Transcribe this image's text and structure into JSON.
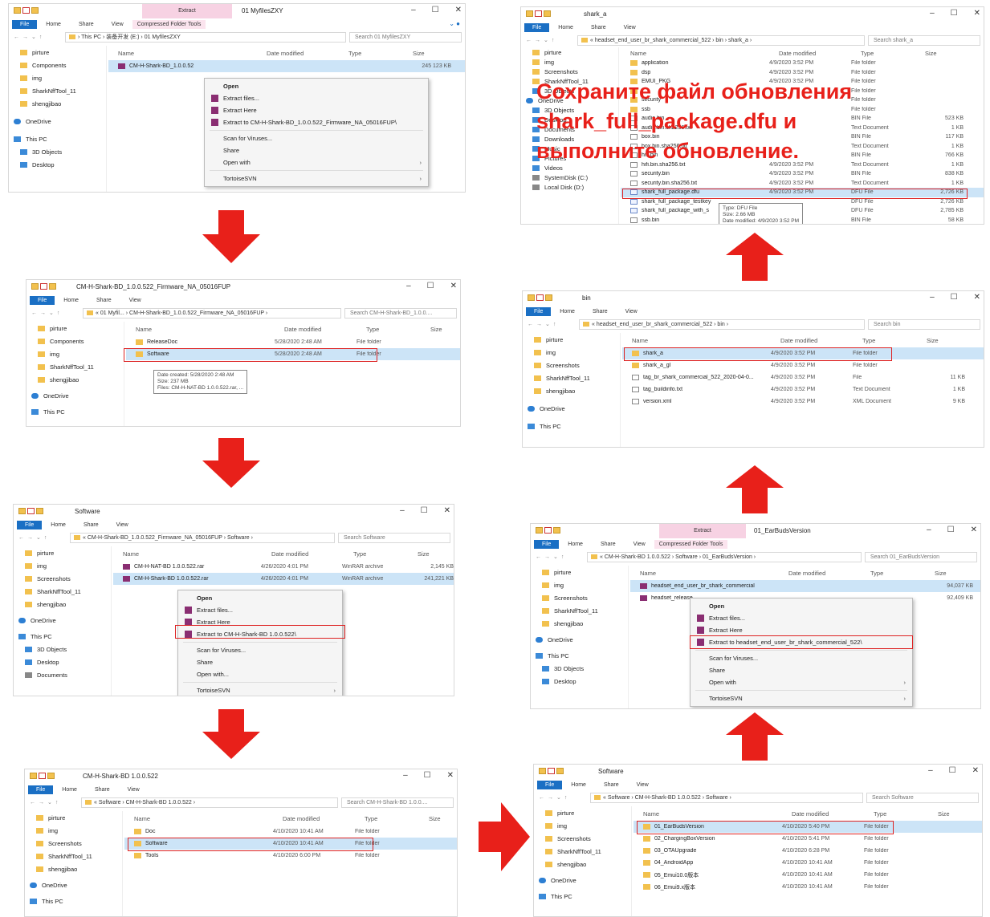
{
  "overlay_text": [
    "Сохраните файл обновления",
    "shark_full_package.dfu и",
    "выполните обновление."
  ],
  "common": {
    "file": "File",
    "home": "Home",
    "share": "Share",
    "view": "View",
    "extract": "Extract",
    "cft": "Compressed Folder Tools",
    "col_name": "Name",
    "col_date": "Date modified",
    "col_type": "Type",
    "col_size": "Size",
    "onedrive": "OneDrive",
    "thispc": "This PC"
  },
  "w1": {
    "title": "01 MyfilesZXY",
    "addr": "› This PC › 装备开发 (E:) › 01 MyfilesZXY",
    "search": "Search 01 MyfilesZXY",
    "nav": [
      "pirture",
      "Components",
      "img",
      "SharkNffTool_11",
      "shengjibao",
      "OneDrive",
      "This PC",
      "3D Objects",
      "Desktop"
    ],
    "row": {
      "name": "CM-H-Shark-BD_1.0.0.52",
      "date": "",
      "type": "",
      "size": "245 123 KB"
    },
    "menu": [
      "Open",
      "Extract files...",
      "Extract Here",
      "Extract to CM-H-Shark-BD_1.0.0.522_Firmware_NA_05016FUP\\",
      "Scan for Viruses...",
      "Share",
      "Open with",
      "TortoiseSVN"
    ]
  },
  "w2": {
    "title": "CM-H-Shark-BD_1.0.0.522_Firmware_NA_05016FUP",
    "addr": "« 01 Myfil... › CM-H-Shark-BD_1.0.0.522_Firmware_NA_05016FUP ›",
    "search": "Search CM-H-Shark-BD_1.0.0....",
    "nav": [
      "pirture",
      "Components",
      "img",
      "SharkNffTool_11",
      "shengjibao",
      "OneDrive",
      "This PC"
    ],
    "rows": [
      {
        "name": "ReleaseDoc",
        "date": "5/28/2020 2:48 AM",
        "type": "File folder"
      },
      {
        "name": "Software",
        "date": "5/28/2020 2:48 AM",
        "type": "File folder"
      }
    ],
    "tip": [
      "Date created: 5/28/2020 2:48 AM",
      "Size: 237 MB",
      "Files: CM-H-NAT-BD 1.0.0.522.rar, ..."
    ]
  },
  "w3": {
    "title": "Software",
    "addr": "« CM-H-Shark-BD_1.0.0.522_Firmware_NA_05016FUP › Software ›",
    "search": "Search Software",
    "nav": [
      "pirture",
      "img",
      "Screenshots",
      "SharkNffTool_11",
      "shengjibao",
      "OneDrive",
      "This PC",
      "3D Objects",
      "Desktop",
      "Documents"
    ],
    "rows": [
      {
        "name": "CM-H-NAT-BD 1.0.0.522.rar",
        "date": "4/26/2020 4:01 PM",
        "type": "WinRAR archive",
        "size": "2,145 KB"
      },
      {
        "name": "CM-H-Shark-BD 1.0.0.522.rar",
        "date": "4/26/2020 4:01 PM",
        "type": "WinRAR archive",
        "size": "241,221 KB"
      }
    ],
    "menu": [
      "Open",
      "Extract files...",
      "Extract Here",
      "Extract to CM-H-Shark-BD 1.0.0.522\\",
      "Scan for Viruses...",
      "Share",
      "Open with...",
      "TortoiseSVN"
    ]
  },
  "w4": {
    "title": "CM-H-Shark-BD 1.0.0.522",
    "addr": "« Software › CM-H-Shark-BD 1.0.0.522 ›",
    "search": "Search CM-H-Shark-BD 1.0.0....",
    "nav": [
      "pirture",
      "img",
      "Screenshots",
      "SharkNffTool_11",
      "shengjibao",
      "OneDrive",
      "This PC"
    ],
    "rows": [
      {
        "name": "Doc",
        "date": "4/10/2020 10:41 AM",
        "type": "File folder"
      },
      {
        "name": "Software",
        "date": "4/10/2020 10:41 AM",
        "type": "File folder"
      },
      {
        "name": "Tools",
        "date": "4/10/2020 6:00 PM",
        "type": "File folder"
      }
    ]
  },
  "w5": {
    "title": "Software",
    "addr": "« Software › CM-H-Shark-BD 1.0.0.522 › Software ›",
    "search": "Search Software",
    "nav": [
      "pirture",
      "img",
      "Screenshots",
      "SharkNffTool_11",
      "shengjibao",
      "OneDrive",
      "This PC"
    ],
    "rows": [
      {
        "name": "01_EarBudsVersion",
        "date": "4/10/2020 5:40 PM",
        "type": "File folder"
      },
      {
        "name": "02_ChargingBoxVersion",
        "date": "4/10/2020 5:41 PM",
        "type": "File folder"
      },
      {
        "name": "03_OTAUpgrade",
        "date": "4/10/2020 6:28 PM",
        "type": "File folder"
      },
      {
        "name": "04_AndroidApp",
        "date": "4/10/2020 10:41 AM",
        "type": "File folder"
      },
      {
        "name": "05_Emui10.0版本",
        "date": "4/10/2020 10:41 AM",
        "type": "File folder"
      },
      {
        "name": "06_Emui9.x版本",
        "date": "4/10/2020 10:41 AM",
        "type": "File folder"
      }
    ]
  },
  "w6": {
    "title": "01_EarBudsVersion",
    "addr": "« CM-H-Shark-BD 1.0.0.522 › Software › 01_EarBudsVersion ›",
    "search": "Search 01_EarBudsVersion",
    "nav": [
      "pirture",
      "img",
      "Screenshots",
      "SharkNffTool_11",
      "shengjibao",
      "OneDrive",
      "This PC",
      "3D Objects",
      "Desktop"
    ],
    "rows": [
      {
        "name": "headset_end_user_br_shark_commercial",
        "size": "94,037 KB"
      },
      {
        "name": "headset_release",
        "size": "92,409 KB"
      }
    ],
    "menu": [
      "Open",
      "Extract files...",
      "Extract Here",
      "Extract to headset_end_user_br_shark_commercial_522\\",
      "Scan for Viruses...",
      "Share",
      "Open with",
      "TortoiseSVN"
    ]
  },
  "w7": {
    "title": "bin",
    "addr": "« headset_end_user_br_shark_commercial_522 › bin ›",
    "search": "Search bin",
    "nav": [
      "pirture",
      "img",
      "Screenshots",
      "SharkNffTool_11",
      "shengjibao",
      "OneDrive",
      "This PC"
    ],
    "rows": [
      {
        "name": "shark_a",
        "date": "4/9/2020 3:52 PM",
        "type": "File folder",
        "size": ""
      },
      {
        "name": "shark_a_gl",
        "date": "4/9/2020 3:52 PM",
        "type": "File folder",
        "size": ""
      },
      {
        "name": "tag_br_shark_commercial_522_2020-04-0...",
        "date": "4/9/2020 3:52 PM",
        "type": "File",
        "size": "11 KB"
      },
      {
        "name": "tag_buildinfo.txt",
        "date": "4/9/2020 3:52 PM",
        "type": "Text Document",
        "size": "1 KB"
      },
      {
        "name": "version.xml",
        "date": "4/9/2020 3:52 PM",
        "type": "XML Document",
        "size": "9 KB"
      }
    ]
  },
  "w8": {
    "title": "shark_a",
    "addr": "« headset_end_user_br_shark_commercial_522 › bin › shark_a ›",
    "search": "Search shark_a",
    "nav": [
      "pirture",
      "img",
      "Screenshots",
      "SharkNffTool_11",
      "3D Objects",
      "OneDrive",
      "3D Objects",
      "Desktop",
      "Documents",
      "Downloads",
      "Music",
      "Pictures",
      "Videos",
      "SystemDisk (C:)",
      "Local Disk (D:)"
    ],
    "rows": [
      {
        "name": "application",
        "date": "4/9/2020 3:52 PM",
        "type": "File folder",
        "size": ""
      },
      {
        "name": "dsp",
        "date": "4/9/2020 3:52 PM",
        "type": "File folder",
        "size": ""
      },
      {
        "name": "EMUI_PKG",
        "date": "4/9/2020 3:52 PM",
        "type": "File folder",
        "size": ""
      },
      {
        "name": "",
        "date": "",
        "type": "File folder",
        "size": ""
      },
      {
        "name": "security",
        "date": "",
        "type": "File folder",
        "size": ""
      },
      {
        "name": "ssb",
        "date": "",
        "type": "File folder",
        "size": ""
      },
      {
        "name": "audio.bin",
        "date": "",
        "type": "BIN File",
        "size": "523 KB"
      },
      {
        "name": "audio.bin.sha256.txt",
        "date": "",
        "type": "Text Document",
        "size": "1 KB"
      },
      {
        "name": "box.bin",
        "date": "",
        "type": "BIN File",
        "size": "117 KB"
      },
      {
        "name": "box.bin.sha256.txt",
        "date": "",
        "type": "Text Document",
        "size": "1 KB"
      },
      {
        "name": "hifi.bin",
        "date": "",
        "type": "BIN File",
        "size": "766 KB"
      },
      {
        "name": "hifi.bin.sha256.txt",
        "date": "4/9/2020 3:52 PM",
        "type": "Text Document",
        "size": "1 KB"
      },
      {
        "name": "security.bin",
        "date": "4/9/2020 3:52 PM",
        "type": "BIN File",
        "size": "838 KB"
      },
      {
        "name": "security.bin.sha256.txt",
        "date": "4/9/2020 3:52 PM",
        "type": "Text Document",
        "size": "1 KB"
      },
      {
        "name": "shark_full_package.dfu",
        "date": "4/9/2020 3:52 PM",
        "type": "DFU File",
        "size": "2,726 KB"
      },
      {
        "name": "shark_full_package_testkey",
        "date": "",
        "type": "DFU File",
        "size": "2,726 KB"
      },
      {
        "name": "shark_full_package_with_s",
        "date": "",
        "type": "DFU File",
        "size": "2,785 KB"
      },
      {
        "name": "ssb.bin",
        "date": "",
        "type": "BIN File",
        "size": "58 KB"
      }
    ],
    "tip": [
      "Type: DFU File",
      "Size: 2.66 MB",
      "Date modified: 4/9/2020 3:52 PM"
    ]
  }
}
